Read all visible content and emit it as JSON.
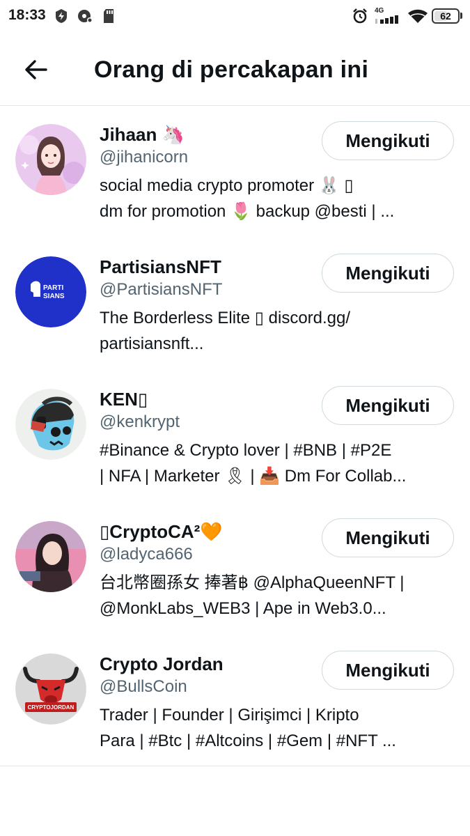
{
  "status_bar": {
    "time": "18:33",
    "network": "4G",
    "battery": "62",
    "battery_level": 0.62,
    "icons": [
      "charging-bolt-icon",
      "sync-disc-icon",
      "sd-card-icon",
      "alarm-icon",
      "signal-icon",
      "wifi-icon",
      "battery-icon"
    ]
  },
  "header": {
    "title": "Orang di percakapan ini",
    "back_icon": "arrow-left-icon"
  },
  "users": [
    {
      "name": "Jihaan 🦄",
      "handle": "@jihanicorn",
      "bio": [
        "social media crypto promoter 🐰 ▯",
        "dm for promotion 🌷 backup @besti | ..."
      ],
      "button": "Mengikuti"
    },
    {
      "name": "PartisiansNFT",
      "handle": "@PartisiansNFT",
      "bio": [
        "The Borderless Elite ▯ discord.gg/",
        "partisiansnft..."
      ],
      "button": "Mengikuti",
      "avatar_text": [
        "PARTI",
        "SIANS"
      ]
    },
    {
      "name": "KEN▯",
      "handle": "@kenkrypt",
      "bio": [
        "#Binance & Crypto lover | #BNB | #P2E",
        "| NFA | Marketer 🎗 | 📥 Dm For Collab..."
      ],
      "button": "Mengikuti"
    },
    {
      "name": "▯CryptoCA²🧡",
      "handle": "@ladyca666",
      "bio": [
        "台北幣圈孫女 捧著฿ @AlphaQueenNFT |",
        "@MonkLabs_WEB3 | Ape in Web3.0..."
      ],
      "button": "Mengikuti"
    },
    {
      "name": "Crypto Jordan",
      "handle": "@BullsCoin",
      "bio": [
        "Trader | Founder | Girişimci | Kripto",
        "Para | #Btc | #Altcoins | #Gem | #NFT ..."
      ],
      "button": "Mengikuti",
      "avatar_text": [
        "CRYPTOJORDAN"
      ]
    }
  ]
}
